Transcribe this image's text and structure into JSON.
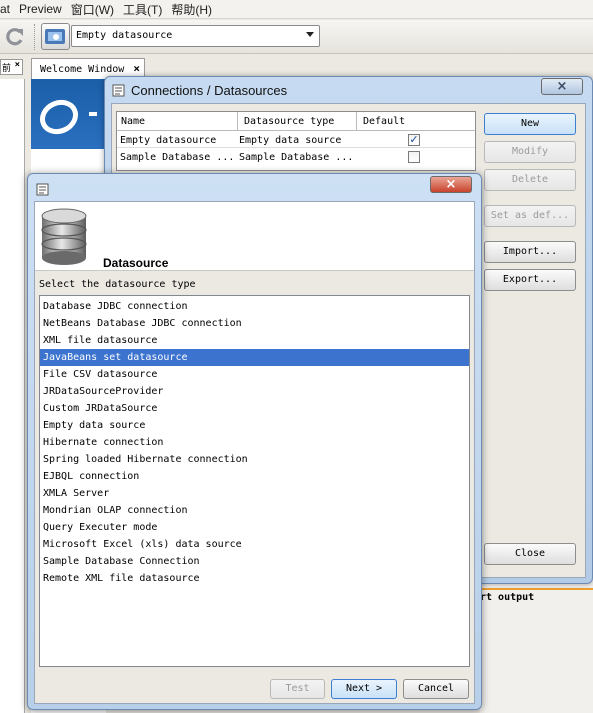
{
  "menubar": {
    "items": [
      "at",
      "Preview",
      "窗口(W)",
      "工具(T)",
      "帮助(H)"
    ]
  },
  "toolbar": {
    "datasource_selected": "Empty datasource"
  },
  "tabs": {
    "left_stub": "前",
    "welcome": "Welcome Window"
  },
  "background": {
    "output_label": "rt output"
  },
  "connections_dialog": {
    "title": "Connections / Datasources",
    "columns": [
      "Name",
      "Datasource type",
      "Default"
    ],
    "rows": [
      {
        "name": "Empty datasource",
        "type": "Empty data source",
        "default": true
      },
      {
        "name": "Sample Database ...",
        "type": "Sample Database ...",
        "default": false
      }
    ],
    "buttons": {
      "new": "New",
      "modify": "Modify",
      "delete": "Delete",
      "set_default": "Set as def...",
      "import": "Import...",
      "export": "Export...",
      "close": "Close"
    }
  },
  "datasource_dialog": {
    "heading": "Datasource",
    "prompt": "Select the datasource type",
    "selected_index": 3,
    "items": [
      "Database JDBC connection",
      "NetBeans Database JDBC connection",
      "XML file datasource",
      "JavaBeans set datasource",
      "File CSV datasource",
      "JRDataSourceProvider",
      "Custom JRDataSource",
      "Empty data source",
      "Hibernate connection",
      "Spring loaded Hibernate connection",
      "EJBQL connection",
      "XMLA Server",
      "Mondrian OLAP connection",
      "Query Executer mode",
      "Microsoft Excel (xls) data source",
      "Sample Database Connection",
      "Remote XML file datasource"
    ],
    "buttons": {
      "test": "Test",
      "next": "Next >",
      "cancel": "Cancel"
    }
  },
  "colors": {
    "selection": "#3b73cf",
    "dialog_frame": "#b7cfe9",
    "close_red": "#c8432c"
  }
}
